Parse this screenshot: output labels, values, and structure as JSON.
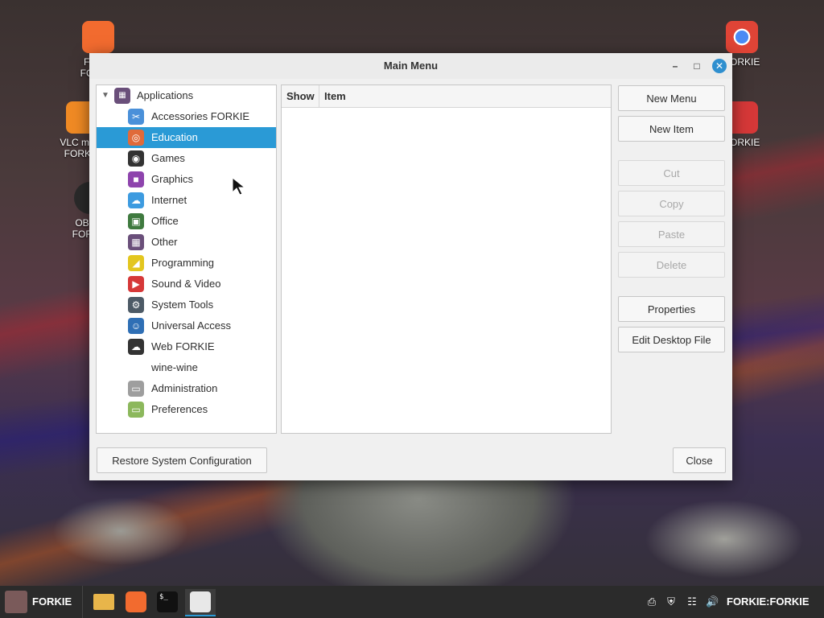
{
  "desktop": {
    "icons_left": [
      {
        "label": "Firef… FORKIE",
        "icon": "firefox-icon"
      },
      {
        "label": "VLC me… FORKIE",
        "icon": "vlc-icon"
      },
      {
        "label": "OBS… FORKIE",
        "icon": "obs-icon"
      }
    ],
    "icons_right": [
      {
        "label": "FORKIE",
        "icon": "chrome-icon"
      },
      {
        "label": "FORKIE",
        "icon": "app-icon"
      }
    ]
  },
  "dialog": {
    "title": "Main Menu",
    "tree": {
      "root": "Applications",
      "items": [
        {
          "label": "Accessories FORKIE",
          "icon": "scissors-icon",
          "color": "#4a90d9"
        },
        {
          "label": "Education",
          "icon": "education-icon",
          "color": "#e06a3a",
          "selected": true
        },
        {
          "label": "Games",
          "icon": "gamepad-icon",
          "color": "#333333"
        },
        {
          "label": "Graphics",
          "icon": "graphics-icon",
          "color": "#8e44ad"
        },
        {
          "label": "Internet",
          "icon": "cloud-icon",
          "color": "#3d9be0"
        },
        {
          "label": "Office",
          "icon": "office-icon",
          "color": "#3f7a3f"
        },
        {
          "label": "Other",
          "icon": "grid-icon",
          "color": "#6a4f7a"
        },
        {
          "label": "Programming",
          "icon": "programming-icon",
          "color": "#e3c61f"
        },
        {
          "label": "Sound & Video",
          "icon": "play-icon",
          "color": "#d63838"
        },
        {
          "label": "System Tools",
          "icon": "gear-icon",
          "color": "#4d5a66"
        },
        {
          "label": "Universal Access",
          "icon": "accessibility-icon",
          "color": "#2f6fb5"
        },
        {
          "label": "Web FORKIE",
          "icon": "web-icon",
          "color": "#333333"
        },
        {
          "label": "wine-wine",
          "icon": "",
          "color": ""
        },
        {
          "label": "Administration",
          "icon": "toggle-icon",
          "color": "#9e9e9e"
        },
        {
          "label": "Preferences",
          "icon": "toggle-green-icon",
          "color": "#8cb85c"
        }
      ]
    },
    "columns": {
      "show": "Show",
      "item": "Item"
    },
    "buttons": {
      "new_menu": "New Menu",
      "new_item": "New Item",
      "cut": "Cut",
      "copy": "Copy",
      "paste": "Paste",
      "delete": "Delete",
      "properties": "Properties",
      "edit_desktop_file": "Edit Desktop File",
      "restore": "Restore System Configuration",
      "close": "Close"
    }
  },
  "taskbar": {
    "start_label": "FORKIE",
    "clock_label": "FORKIE:FORKIE"
  }
}
